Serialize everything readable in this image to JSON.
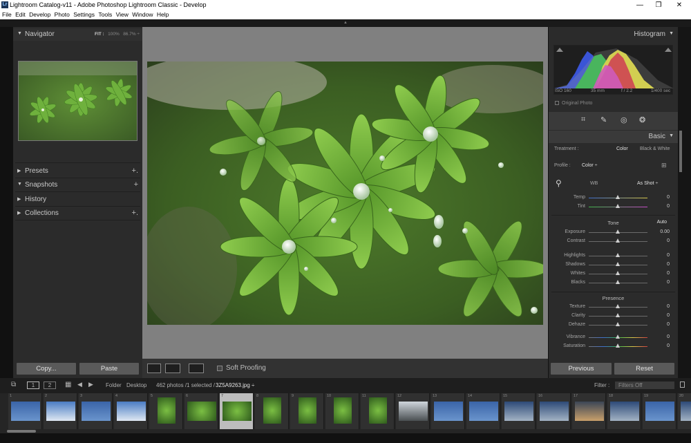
{
  "window": {
    "title": "Lightroom Catalog-v11 - Adobe Photoshop Lightroom Classic - Develop",
    "app_icon_text": "Lr",
    "controls": {
      "minimize": "—",
      "maximize": "❐",
      "close": "✕"
    }
  },
  "menu": [
    "File",
    "Edit",
    "Develop",
    "Photo",
    "Settings",
    "Tools",
    "View",
    "Window",
    "Help"
  ],
  "left_panel": {
    "navigator": {
      "label": "Navigator",
      "zoom_fit": "FIT :",
      "zoom_100": "100%",
      "zoom_pct": "86.7% ÷"
    },
    "sections": [
      {
        "label": "Presets",
        "expanded": false,
        "action": "+."
      },
      {
        "label": "Snapshots",
        "expanded": true,
        "action": "+"
      },
      {
        "label": "History",
        "expanded": false,
        "action": ""
      },
      {
        "label": "Collections",
        "expanded": false,
        "action": "+."
      }
    ],
    "copy_button": "Copy...",
    "paste_button": "Paste"
  },
  "toolbar": {
    "soft_proofing": "Soft Proofing"
  },
  "right_panel": {
    "histogram": {
      "label": "Histogram"
    },
    "exif": {
      "iso": "ISO 160",
      "focal": "35 mm",
      "aperture": "f / 2.2",
      "shutter": "1/400 sec"
    },
    "original_photo": "Original Photo",
    "basic": {
      "label": "Basic",
      "treatment_label": "Treatment :",
      "treatment_color": "Color",
      "treatment_bw": "Black & White",
      "profile_label": "Profile :",
      "profile_value": "Color ÷",
      "wb_label": "WB",
      "wb_value": "As Shot ÷",
      "tone_label": "Tone",
      "auto_label": "Auto",
      "presence_label": "Presence",
      "sliders": [
        {
          "label": "Temp",
          "value": "0"
        },
        {
          "label": "Tint",
          "value": "0"
        },
        {
          "label": "Exposure",
          "value": "0.00"
        },
        {
          "label": "Contrast",
          "value": "0"
        },
        {
          "label": "Highlights",
          "value": "0"
        },
        {
          "label": "Shadows",
          "value": "0"
        },
        {
          "label": "Whites",
          "value": "0"
        },
        {
          "label": "Blacks",
          "value": "0"
        },
        {
          "label": "Texture",
          "value": "0"
        },
        {
          "label": "Clarity",
          "value": "0"
        },
        {
          "label": "Dehaze",
          "value": "0"
        },
        {
          "label": "Vibrance",
          "value": "0"
        },
        {
          "label": "Saturation",
          "value": "0"
        }
      ]
    },
    "previous_button": "Previous",
    "reset_button": "Reset"
  },
  "filmstrip_bar": {
    "screen1": "1",
    "screen2": "2",
    "source_folder": "Folder",
    "source_name": "Desktop",
    "count": "462 photos /1 selected /",
    "filename": "3Z5A9263.jpg ÷",
    "filter_label": "Filter :",
    "filter_value": "Filters Off"
  },
  "filmstrip": [
    {
      "num": "1",
      "kind": "sky"
    },
    {
      "num": "2",
      "kind": "clouds"
    },
    {
      "num": "3",
      "kind": "sky"
    },
    {
      "num": "4",
      "kind": "clouds"
    },
    {
      "num": "5",
      "kind": "plant"
    },
    {
      "num": "6",
      "kind": "plant"
    },
    {
      "num": "7",
      "kind": "plant",
      "selected": true
    },
    {
      "num": "8",
      "kind": "plant"
    },
    {
      "num": "9",
      "kind": "plant"
    },
    {
      "num": "10",
      "kind": "plant"
    },
    {
      "num": "11",
      "kind": "plant"
    },
    {
      "num": "12",
      "kind": "mountain"
    },
    {
      "num": "13",
      "kind": "sky"
    },
    {
      "num": "14",
      "kind": "sky"
    },
    {
      "num": "15",
      "kind": "dusk"
    },
    {
      "num": "16",
      "kind": "dusk"
    },
    {
      "num": "17",
      "kind": "sunset"
    },
    {
      "num": "18",
      "kind": "dusk"
    },
    {
      "num": "19",
      "kind": "sky"
    },
    {
      "num": "20",
      "kind": "dusk"
    }
  ]
}
